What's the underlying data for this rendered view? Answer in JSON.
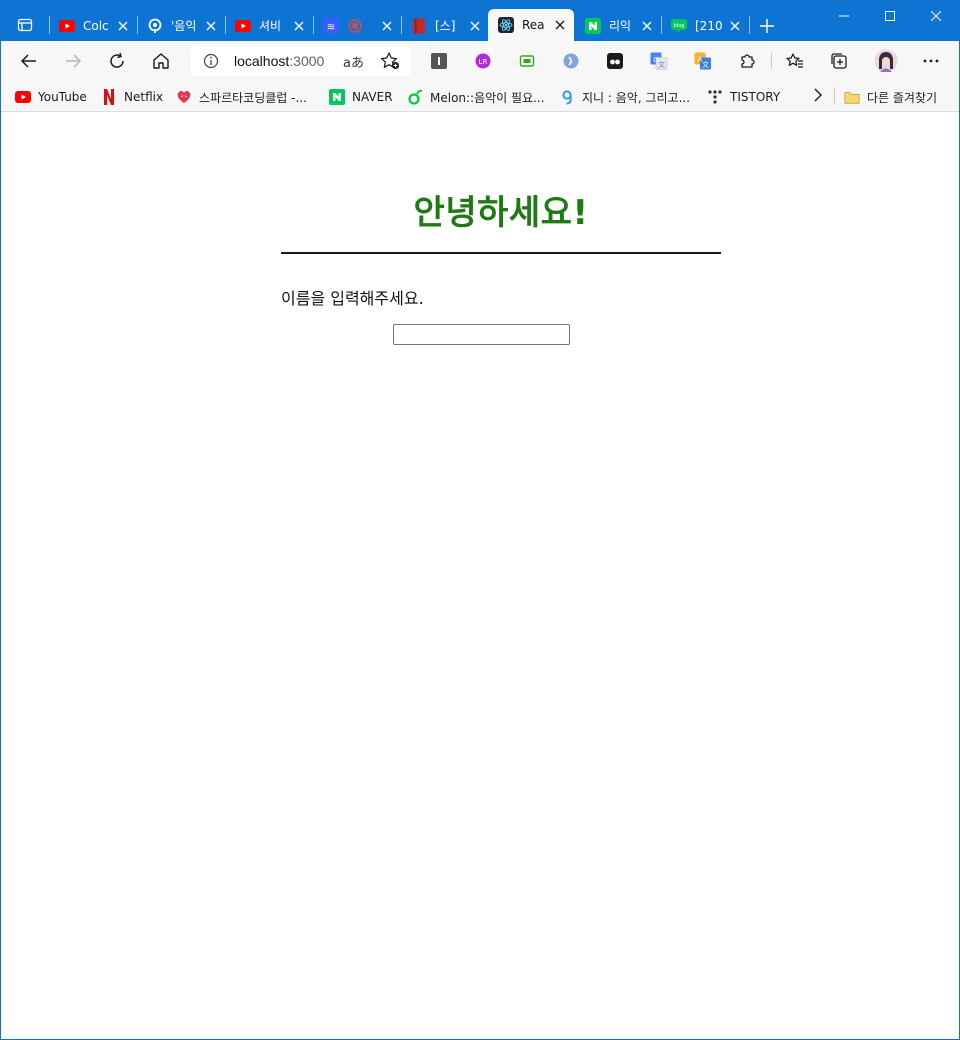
{
  "tabs": [
    {
      "title": "Colc",
      "icon": "youtube-icon"
    },
    {
      "title": "'음익",
      "icon": "genie-icon"
    },
    {
      "title": "셔비",
      "icon": "youtube-icon"
    },
    {
      "title": "",
      "icon": "extension-tab-icon"
    },
    {
      "title": "[스]",
      "icon": "book-icon"
    },
    {
      "title": "Rea",
      "icon": "react-icon",
      "active": true
    },
    {
      "title": "리익",
      "icon": "naver-icon"
    },
    {
      "title": "[210",
      "icon": "blog-icon"
    }
  ],
  "toolbar": {
    "url_host": "localhost",
    "url_port": ":3000",
    "read_aloud": "aあ"
  },
  "bookmarks": [
    {
      "label": "YouTube",
      "icon": "youtube-icon"
    },
    {
      "label": "Netflix",
      "icon": "netflix-icon"
    },
    {
      "label": "스파르타코딩클럽 -...",
      "icon": "sparta-icon"
    },
    {
      "label": "NAVER",
      "icon": "naver-icon"
    },
    {
      "label": "Melon::음악이 필요...",
      "icon": "melon-icon"
    },
    {
      "label": "지니 : 음악, 그리고...",
      "icon": "genie-icon"
    },
    {
      "label": "TISTORY",
      "icon": "tistory-icon"
    }
  ],
  "other_favorites": "다른 즐겨찾기",
  "page": {
    "heading": "안녕하세요!",
    "prompt": "이름을 입력해주세요.",
    "input_value": ""
  },
  "colors": {
    "titlebar": "#0e74d4",
    "heading": "#1e7b12"
  }
}
